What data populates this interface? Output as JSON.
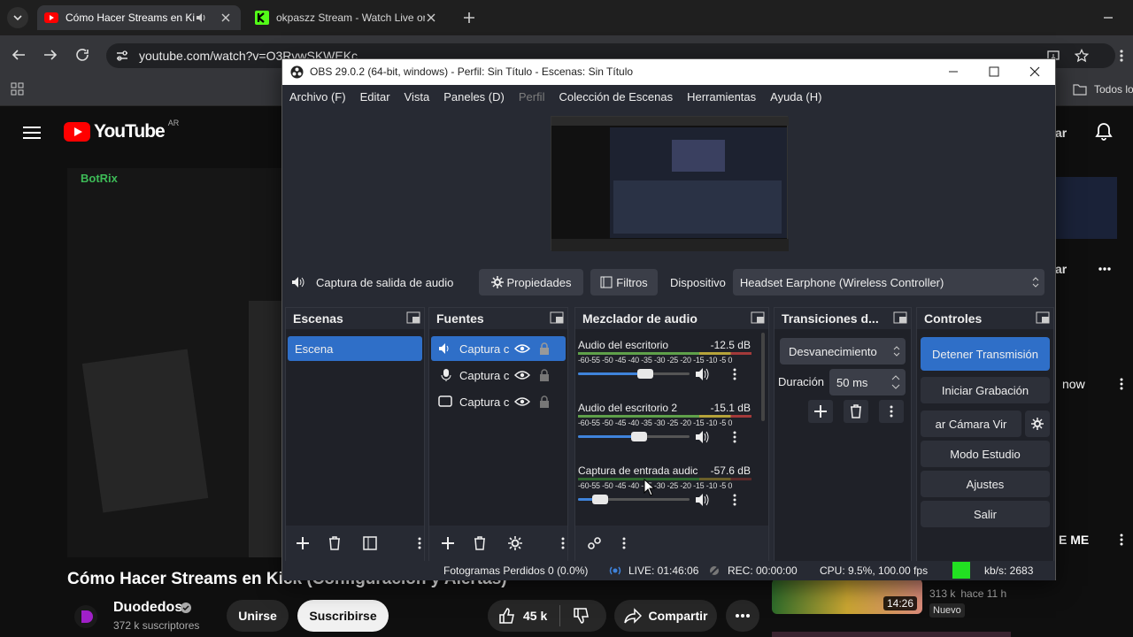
{
  "browser": {
    "tabs": [
      {
        "title": "Cómo Hacer Streams en Kick",
        "active": true
      },
      {
        "title": "okpaszz Stream - Watch Live on",
        "active": false
      }
    ],
    "url": "youtube.com/watch?v=O3RvwSKWEKc",
    "bookmarks_label": "Todos lo"
  },
  "youtube": {
    "logo": "YouTube",
    "region": "AR",
    "video_title": "Cómo Hacer Streams en Kick (Configuración y Alertas)",
    "channel": "Duodedos",
    "subscribers": "372 k suscriptores",
    "join_label": "Unirse",
    "subscribe_label": "Suscribirse",
    "likes": "45 k",
    "share_label": "Compartir",
    "right_partial_1": "ar",
    "right_partial_2": "ar",
    "right_partial_3": "now",
    "right_partial_4": "E ME",
    "side_thumb_time": "14:26",
    "side_views": "313 k",
    "side_ago": "hace 11 h",
    "side_badge": "Nuevo",
    "embedded_brand": "BotRix"
  },
  "obs": {
    "title": "OBS 29.0.2 (64-bit, windows) - Perfil: Sin Título - Escenas: Sin Título",
    "menu": [
      "Archivo (F)",
      "Editar",
      "Vista",
      "Paneles (D)",
      "Perfil",
      "Colección de Escenas",
      "Herramientas",
      "Ayuda (H)"
    ],
    "source_bar": {
      "source": "Captura de salida de audio",
      "properties": "Propiedades",
      "filters": "Filtros",
      "device_label": "Dispositivo",
      "device": "Headset Earphone (Wireless Controller)"
    },
    "docks": {
      "scenes": "Escenas",
      "sources": "Fuentes",
      "mixer": "Mezclador de audio",
      "transitions": "Transiciones d...",
      "controls": "Controles"
    },
    "scenes": [
      "Escena"
    ],
    "sources": [
      "Captura c",
      "Captura c",
      "Captura c"
    ],
    "mixer": [
      {
        "name": "Audio del escritorio",
        "db": "-12.5 dB",
        "volume": 0.6
      },
      {
        "name": "Audio del escritorio 2",
        "db": "-15.1 dB",
        "volume": 0.55
      },
      {
        "name": "Captura de entrada audic",
        "db": "-57.6 dB",
        "volume": 0.2
      }
    ],
    "meter_scale": "-60-55 -50 -45 -40 -35 -30 -25 -20 -15 -10 -5 0",
    "transition": {
      "type": "Desvanecimiento",
      "duration_label": "Duración",
      "duration": "50 ms"
    },
    "controls": [
      "Detener Transmisión",
      "Iniciar Grabación",
      "ar Cámara Vir",
      "Modo Estudio",
      "Ajustes",
      "Salir"
    ],
    "status": {
      "dropped": "Fotogramas Perdidos 0 (0.0%)",
      "live": "LIVE: 01:46:06",
      "rec": "REC: 00:00:00",
      "cpu": "CPU: 9.5%, 100.00 fps",
      "kbs": "kb/s: 2683"
    },
    "colors": {
      "accent": "#3f83db",
      "active_control": "#2f6fc8",
      "status_green": "#22e022"
    }
  }
}
